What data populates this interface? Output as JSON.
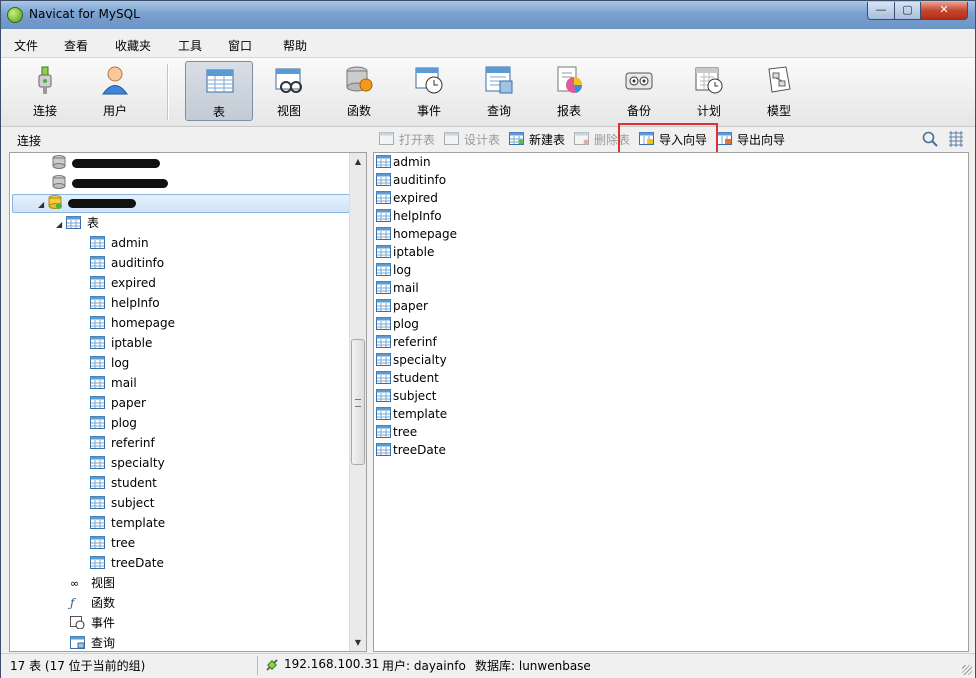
{
  "window": {
    "title": "Navicat for MySQL",
    "minimize": "—",
    "maximize": "▢",
    "close": "✕"
  },
  "menu": [
    "文件",
    "查看",
    "收藏夹",
    "工具",
    "窗口",
    "帮助"
  ],
  "toolbar": [
    {
      "label": "连接",
      "icon": "plug-icon"
    },
    {
      "label": "用户",
      "icon": "user-icon"
    },
    {
      "label": "表",
      "icon": "table-icon",
      "active": true
    },
    {
      "label": "视图",
      "icon": "view-icon"
    },
    {
      "label": "函数",
      "icon": "function-icon"
    },
    {
      "label": "事件",
      "icon": "event-icon"
    },
    {
      "label": "查询",
      "icon": "query-icon"
    },
    {
      "label": "报表",
      "icon": "report-icon"
    },
    {
      "label": "备份",
      "icon": "backup-icon"
    },
    {
      "label": "计划",
      "icon": "schedule-icon"
    },
    {
      "label": "模型",
      "icon": "model-icon"
    }
  ],
  "subbar": {
    "connection_label": "连接",
    "open_table": "打开表",
    "design_table": "设计表",
    "new_table": "新建表",
    "delete_table": "删除表",
    "import_wizard": "导入向导",
    "export_wizard": "导出向导"
  },
  "tree": {
    "database": "lunwenbase",
    "tables_node": "表",
    "views_node": "视图",
    "functions_node": "函数",
    "events_node": "事件",
    "queries_node": "查询"
  },
  "tables": [
    "admin",
    "auditinfo",
    "expired",
    "helpInfo",
    "homepage",
    "iptable",
    "log",
    "mail",
    "paper",
    "plog",
    "referinf",
    "specialty",
    "student",
    "subject",
    "template",
    "tree",
    "treeDate"
  ],
  "status": {
    "count": "17 表 (17 位于当前的组)",
    "host": "192.168.100.31",
    "user": "用户: dayainfo",
    "database": "数据库: lunwenbase"
  },
  "colors": {
    "highlight": "#e03030",
    "selection": "#cfe3f8",
    "titlebar": "#7aa1cf"
  }
}
